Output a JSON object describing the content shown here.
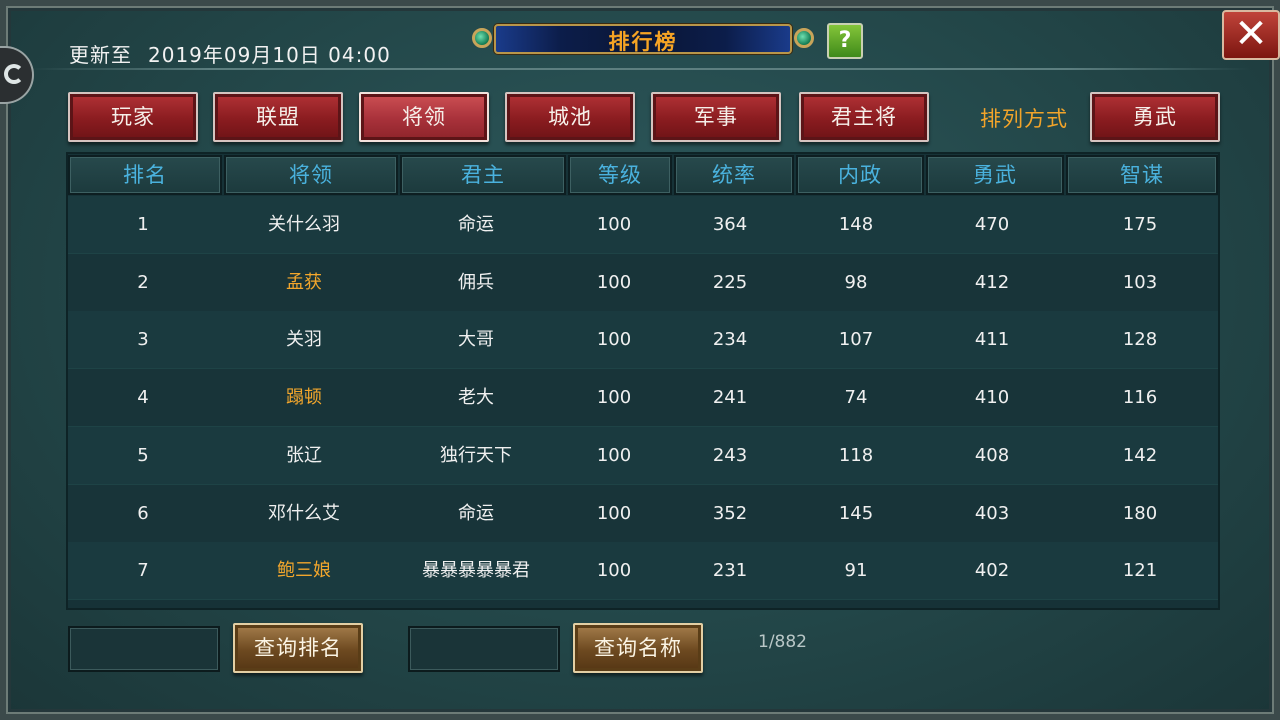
{
  "header": {
    "update_label": "更新至",
    "update_time": "2019年09月10日 04:00",
    "title": "排行榜",
    "help_label": "?",
    "close_label": "✕"
  },
  "tabs": [
    {
      "label": "玩家",
      "active": false
    },
    {
      "label": "联盟",
      "active": false
    },
    {
      "label": "将领",
      "active": true
    },
    {
      "label": "城池",
      "active": false
    },
    {
      "label": "军事",
      "active": false
    },
    {
      "label": "君主将",
      "active": false
    }
  ],
  "sort": {
    "label": "排列方式",
    "value": "勇武"
  },
  "table": {
    "columns": [
      "排名",
      "将领",
      "君主",
      "等级",
      "统率",
      "内政",
      "勇武",
      "智谋"
    ],
    "rows": [
      {
        "rank": "1",
        "general": "关什么羽",
        "general_highlight": false,
        "lord": "命运",
        "level": "100",
        "command": "364",
        "politics": "148",
        "valor": "470",
        "strategy": "175"
      },
      {
        "rank": "2",
        "general": "孟获",
        "general_highlight": true,
        "lord": "佣兵",
        "level": "100",
        "command": "225",
        "politics": "98",
        "valor": "412",
        "strategy": "103"
      },
      {
        "rank": "3",
        "general": "关羽",
        "general_highlight": false,
        "lord": "大哥",
        "level": "100",
        "command": "234",
        "politics": "107",
        "valor": "411",
        "strategy": "128"
      },
      {
        "rank": "4",
        "general": "蹋顿",
        "general_highlight": true,
        "lord": "老大",
        "level": "100",
        "command": "241",
        "politics": "74",
        "valor": "410",
        "strategy": "116"
      },
      {
        "rank": "5",
        "general": "张辽",
        "general_highlight": false,
        "lord": "独行天下",
        "level": "100",
        "command": "243",
        "politics": "118",
        "valor": "408",
        "strategy": "142"
      },
      {
        "rank": "6",
        "general": "邓什么艾",
        "general_highlight": false,
        "lord": "命运",
        "level": "100",
        "command": "352",
        "politics": "145",
        "valor": "403",
        "strategy": "180"
      },
      {
        "rank": "7",
        "general": "鲍三娘",
        "general_highlight": true,
        "lord": "暴暴暴暴暴君",
        "level": "100",
        "command": "231",
        "politics": "91",
        "valor": "402",
        "strategy": "121"
      }
    ]
  },
  "footer": {
    "rank_input_value": "",
    "query_rank_label": "查询排名",
    "name_input_value": "",
    "query_name_label": "查询名称",
    "page_info": "1/882"
  },
  "colors": {
    "highlight_name": "#f2a62c",
    "header_text": "#4ab2de",
    "title_text": "#f6a424"
  }
}
